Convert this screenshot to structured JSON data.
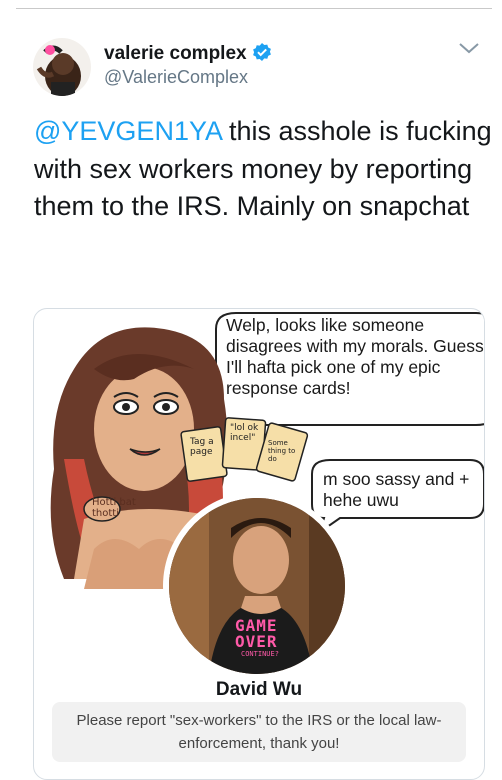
{
  "tweet": {
    "display_name": "valerie complex",
    "handle": "@ValerieComplex",
    "mention": "@YEVGEN1YA",
    "text_after_mention": " this asshole is fucking with sex workers money by reporting them to the IRS. Mainly on snapchat",
    "icons": [
      "verified-badge-icon",
      "chevron-down-icon"
    ],
    "colors": {
      "link": "#1da1f2",
      "verified": "#1da1f2",
      "text": "#14171a",
      "secondary": "#657786"
    }
  },
  "card": {
    "bubble_top_text": "Welp, looks like someone disagrees with my morals. Guess I'll hafta pick one of my epic response cards!",
    "bubble_right_text": "m soo sassy and + hehe uwu",
    "card_note_1": "\"lol ok incel\"",
    "card_note_2": "Tag a page",
    "card_note_3": "Some thing to do",
    "cheek_text": "Hotti bat thotti",
    "shirt_text_1": "GAME",
    "shirt_text_2": "OVER",
    "shirt_text_3": "CONTINUE?",
    "person_name": "David Wu",
    "message": "Please report \"sex-workers\" to the IRS or the local law-enforcement, thank you!"
  }
}
